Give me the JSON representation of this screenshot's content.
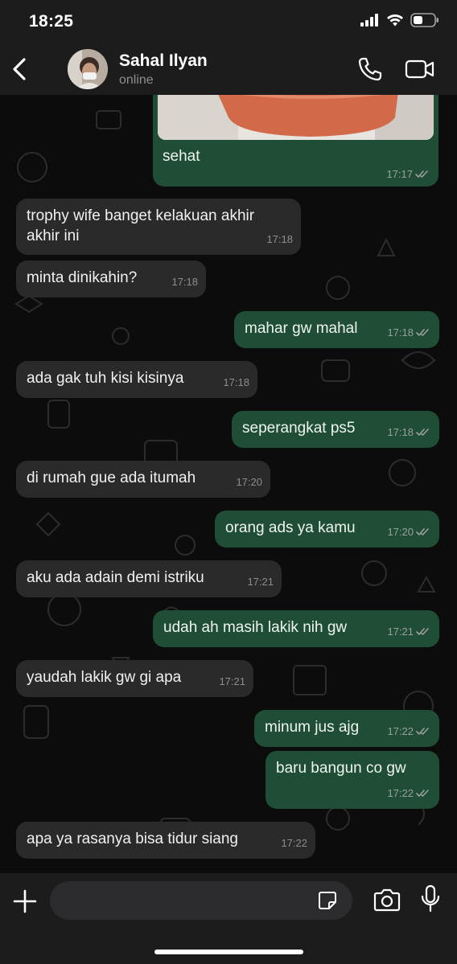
{
  "status_bar": {
    "time": "18:25"
  },
  "header": {
    "contact_name": "Sahal Ilyan",
    "contact_status": "online"
  },
  "messages": [
    {
      "direction": "out",
      "text": "sehat",
      "time": "17:17",
      "read": true,
      "has_image": true
    },
    {
      "direction": "in",
      "text": "trophy wife banget kelakuan akhir akhir ini",
      "time": "17:18"
    },
    {
      "direction": "in",
      "text": "minta dinikahin?",
      "time": "17:18"
    },
    {
      "direction": "out",
      "text": "mahar gw mahal",
      "time": "17:18",
      "read": true
    },
    {
      "direction": "in",
      "text": "ada gak tuh kisi kisinya",
      "time": "17:18"
    },
    {
      "direction": "out",
      "text": "seperangkat ps5",
      "time": "17:18",
      "read": true
    },
    {
      "direction": "in",
      "text": "di rumah gue ada itumah",
      "time": "17:20"
    },
    {
      "direction": "out",
      "text": "orang ads ya kamu",
      "time": "17:20",
      "read": true
    },
    {
      "direction": "in",
      "text": "aku ada adain demi istriku",
      "time": "17:21"
    },
    {
      "direction": "out",
      "text": "udah ah masih lakik nih gw",
      "time": "17:21",
      "read": true
    },
    {
      "direction": "in",
      "text": "yaudah lakik gw gi apa",
      "time": "17:21"
    },
    {
      "direction": "out",
      "text": "minum jus ajg",
      "time": "17:22",
      "read": true
    },
    {
      "direction": "out",
      "text": "baru bangun co gw",
      "time": "17:22",
      "read": true
    },
    {
      "direction": "in",
      "text": "apa ya rasanya bisa tidur siang",
      "time": "17:22"
    }
  ],
  "input": {
    "value": "",
    "placeholder": ""
  },
  "icons": {
    "back": "chevron-left-icon",
    "call": "phone-icon",
    "video": "video-camera-icon",
    "plus": "plus-icon",
    "sticker": "sticker-icon",
    "camera": "camera-icon",
    "mic": "microphone-icon"
  },
  "colors": {
    "incoming_bubble": "#2a2a2b",
    "outgoing_bubble": "#1f4d35",
    "header_bg": "#1c1c1d",
    "chat_bg": "#0c0c0c",
    "read_tick": "#9aa09c"
  }
}
